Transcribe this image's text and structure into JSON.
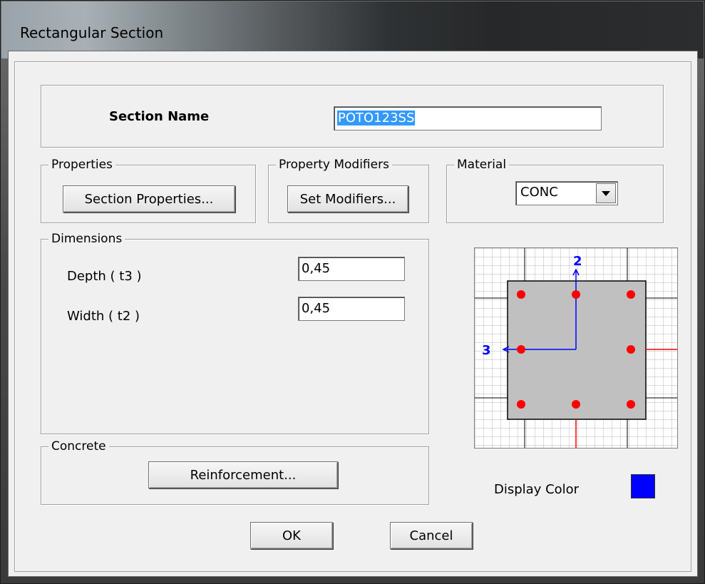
{
  "window": {
    "title": "Rectangular Section"
  },
  "section_name": {
    "label": "Section Name",
    "value": "POTO123SS"
  },
  "properties": {
    "legend": "Properties",
    "button": "Section Properties..."
  },
  "modifiers": {
    "legend": "Property Modifiers",
    "button": "Set Modifiers..."
  },
  "material": {
    "legend": "Material",
    "selected": "CONC"
  },
  "dimensions": {
    "legend": "Dimensions",
    "depth_label": "Depth  ( t3 )",
    "depth_value": "0,45",
    "width_label": "Width  ( t2 )",
    "width_value": "0,45"
  },
  "concrete": {
    "legend": "Concrete",
    "button": "Reinforcement..."
  },
  "preview": {
    "axis2_label": "2",
    "axis3_label": "3",
    "section_fill": "#c0c0c0",
    "rebar_color": "#ff0000",
    "axis_color": "#0000ff"
  },
  "display_color": {
    "label": "Display Color",
    "color": "#0000ff"
  },
  "footer": {
    "ok": "OK",
    "cancel": "Cancel"
  }
}
